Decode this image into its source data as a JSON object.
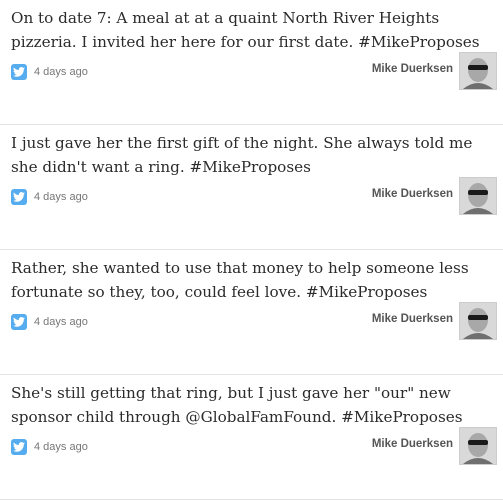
{
  "tweets": [
    {
      "text": "On to date 7: A meal at at a quaint North River Heights pizzeria. I invited her here for our first date. #MikeProposes",
      "timestamp": "4 days ago",
      "author": "Mike Duerksen",
      "source_icon": "twitter-bird-icon",
      "avatar_icon": "profile-photo"
    },
    {
      "text": "I just gave her the first gift of the night. She always told me she didn't want a ring. #MikeProposes",
      "timestamp": "4 days ago",
      "author": "Mike Duerksen",
      "source_icon": "twitter-bird-icon",
      "avatar_icon": "profile-photo"
    },
    {
      "text": "Rather, she wanted to use that money to help someone less fortunate so they, too, could feel love. #MikeProposes",
      "timestamp": "4 days ago",
      "author": "Mike Duerksen",
      "source_icon": "twitter-bird-icon",
      "avatar_icon": "profile-photo"
    },
    {
      "text": "She's still getting that ring, but I just gave her \"our\" new sponsor child through @GlobalFamFound. #MikeProposes",
      "timestamp": "4 days ago",
      "author": "Mike Duerksen",
      "source_icon": "twitter-bird-icon",
      "avatar_icon": "profile-photo"
    }
  ],
  "colors": {
    "twitter_blue": "#55acee",
    "text": "#2b2b2b",
    "meta": "#777777",
    "author": "#555555"
  }
}
